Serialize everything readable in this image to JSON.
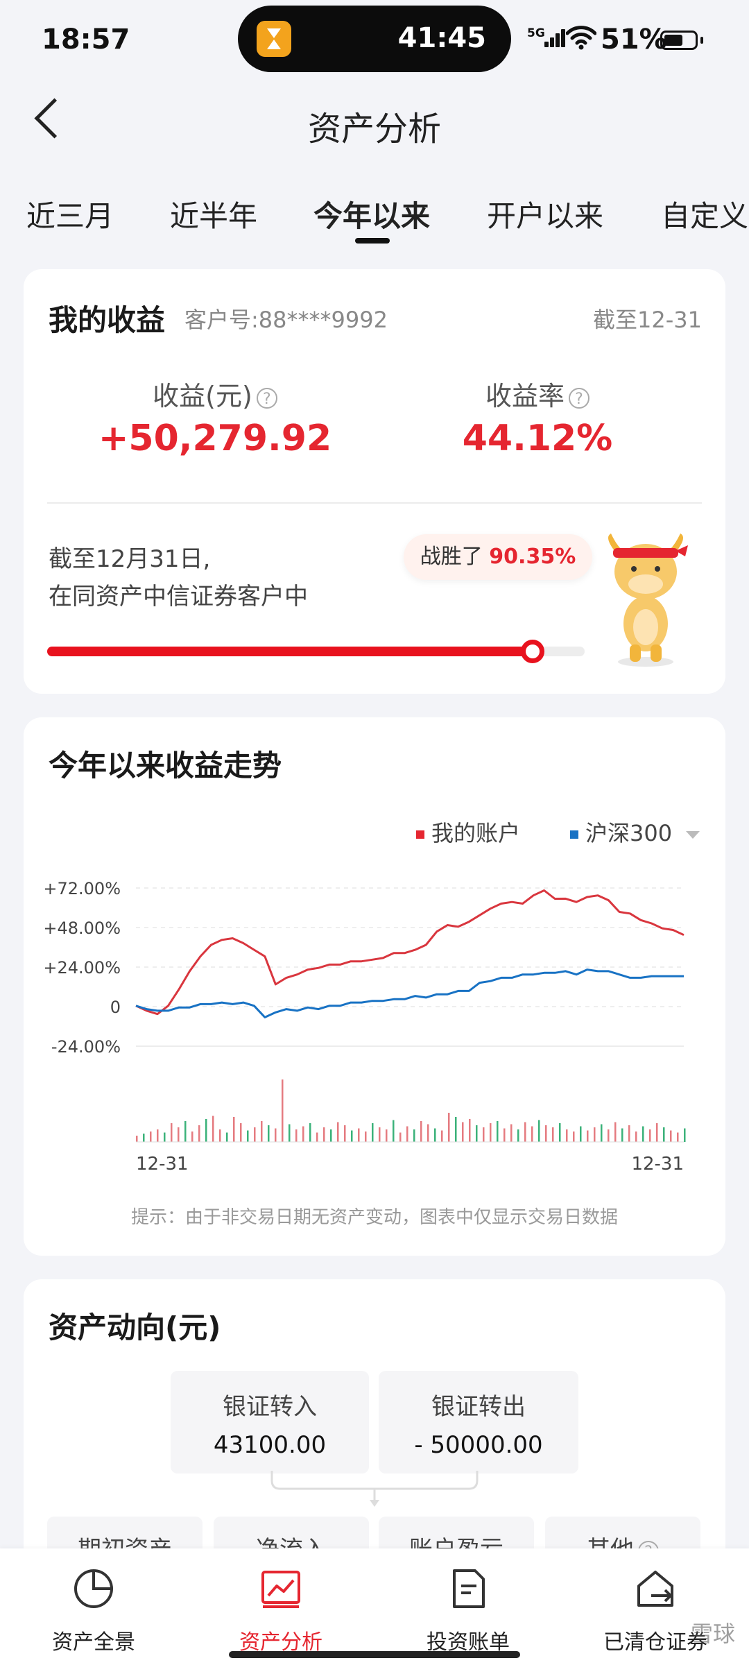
{
  "status": {
    "time": "18:57",
    "island_timer": "41:45",
    "network": "5G",
    "battery": "51%"
  },
  "header": {
    "title": "资产分析"
  },
  "tabs": [
    {
      "label": "近三月"
    },
    {
      "label": "近半年"
    },
    {
      "label": "今年以来",
      "active": true
    },
    {
      "label": "开户以来"
    },
    {
      "label": "自定义"
    }
  ],
  "earnings": {
    "title": "我的收益",
    "customer": "客户号:88****9992",
    "as_of": "截至12-31",
    "profit_label": "收益(元)",
    "profit_value": "+50,279.92",
    "rate_label": "收益率",
    "rate_value": "44.12%",
    "rank_line1": "截至12月31日,",
    "rank_line2": "在同资产中信证券客户中",
    "beat_prefix": "战胜了",
    "beat_value": "90.35%",
    "beat_fraction": 0.9035
  },
  "trend": {
    "title": "今年以来收益走势",
    "legend_mine": "我的账户",
    "legend_index": "沪深300",
    "hint": "提示：由于非交易日期无资产变动，图表中仅显示交易日数据"
  },
  "chart_data": {
    "type": "line",
    "x_start_label": "12-31",
    "x_end_label": "12-31",
    "y_ticks": [
      "+72.00%",
      "+48.00%",
      "+24.00%",
      "0",
      "-24.00%"
    ],
    "ylim": [
      -24,
      72
    ],
    "series": [
      {
        "name": "我的账户",
        "color": "#d9363e",
        "values": [
          0,
          -2,
          -5,
          1,
          10,
          22,
          30,
          38,
          40,
          42,
          38,
          35,
          30,
          14,
          17,
          20,
          22,
          24,
          25,
          26,
          27,
          28,
          28,
          30,
          32,
          33,
          34,
          38,
          45,
          50,
          48,
          52,
          55,
          60,
          62,
          64,
          62,
          68,
          70,
          66,
          65,
          64,
          66,
          68,
          64,
          58,
          56,
          53,
          50,
          48,
          46,
          44
        ]
      },
      {
        "name": "沪深300",
        "color": "#1872c4",
        "values": [
          0,
          -1,
          -3,
          -2,
          -1,
          0,
          1,
          2,
          2,
          2,
          2,
          1,
          -7,
          -3,
          -2,
          -2,
          -1,
          -1,
          0,
          1,
          2,
          3,
          3,
          4,
          4,
          5,
          6,
          6,
          7,
          8,
          9,
          10,
          14,
          16,
          17,
          18,
          19,
          20,
          20,
          21,
          21,
          20,
          22,
          22,
          21,
          20,
          17,
          18,
          18,
          19,
          18,
          19
        ]
      }
    ],
    "volume": [
      6,
      8,
      10,
      12,
      9,
      18,
      14,
      20,
      10,
      16,
      22,
      25,
      12,
      9,
      24,
      18,
      11,
      14,
      20,
      16,
      13,
      60,
      17,
      12,
      15,
      18,
      9,
      14,
      12,
      19,
      16,
      11,
      13,
      10,
      18,
      14,
      12,
      21,
      9,
      15,
      12,
      20,
      17,
      13,
      11,
      28,
      24,
      19,
      22,
      16,
      14,
      18,
      20,
      13,
      17,
      12,
      19,
      15,
      21,
      16,
      14,
      18,
      12,
      10,
      15,
      11,
      14,
      17,
      12,
      19,
      13,
      16,
      10,
      15,
      12,
      18,
      14,
      11,
      9,
      13
    ]
  },
  "flows": {
    "title": "资产动向(元)",
    "in_label": "银证转入",
    "in_value": "43100.00",
    "out_label": "银证转出",
    "out_value": "- 50000.00",
    "row": [
      "期初资产",
      "净流入",
      "账户盈亏",
      "其他"
    ]
  },
  "nav": [
    {
      "label": "资产全景",
      "icon": "pie-chart-icon"
    },
    {
      "label": "资产分析",
      "icon": "line-chart-icon",
      "active": true
    },
    {
      "label": "投资账单",
      "icon": "document-icon"
    },
    {
      "label": "已清仓证券",
      "icon": "house-out-icon"
    }
  ],
  "watermark": "雪球"
}
